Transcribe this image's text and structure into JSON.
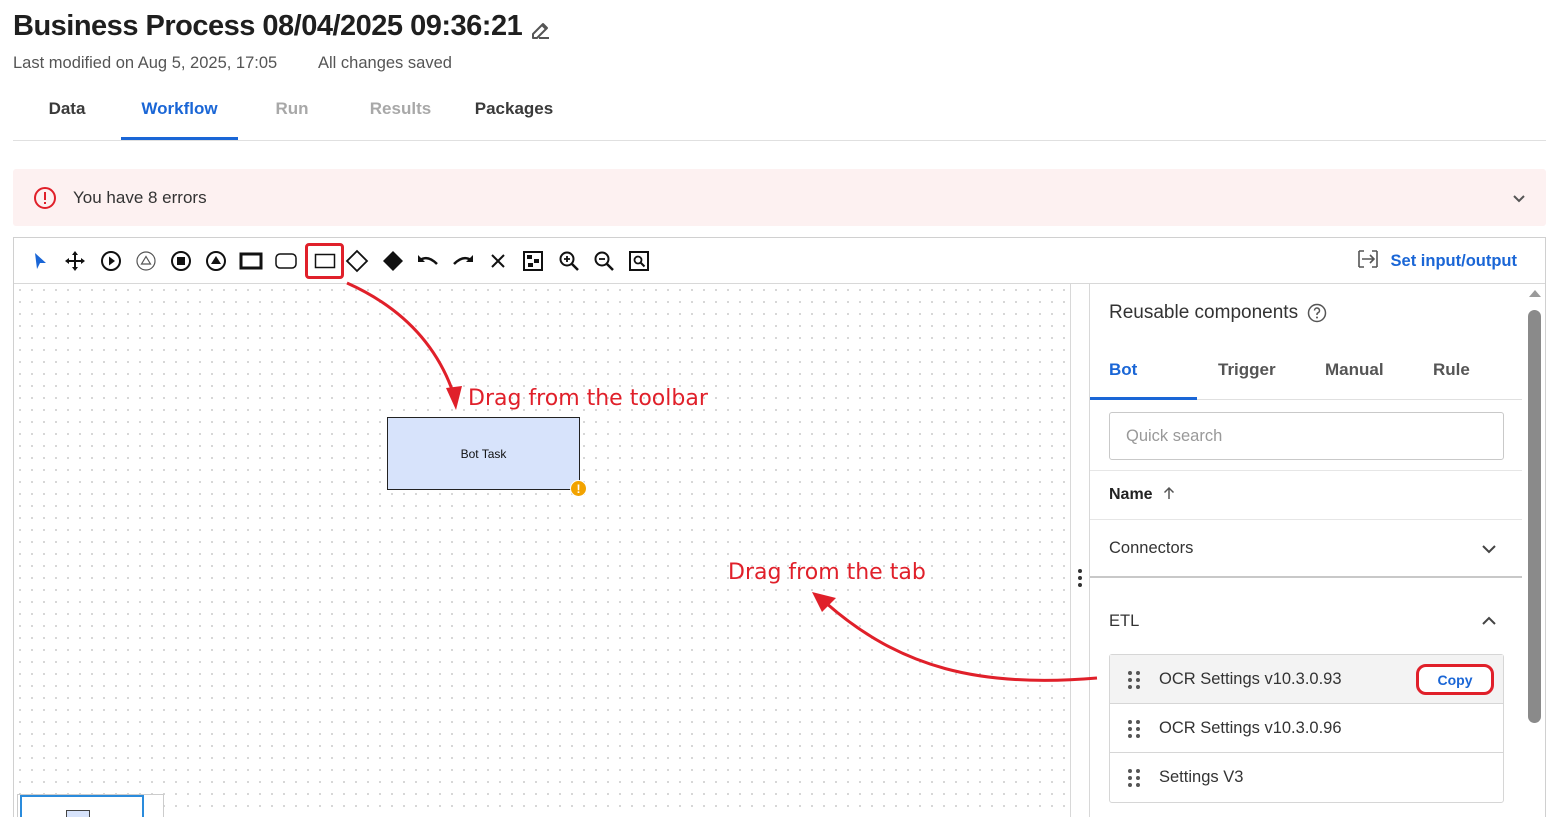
{
  "header": {
    "title": "Business Process 08/04/2025 09:36:21",
    "last_modified": "Last modified on Aug 5, 2025, 17:05",
    "save_status": "All changes saved"
  },
  "tabs": [
    {
      "label": "Data",
      "state": "normal"
    },
    {
      "label": "Workflow",
      "state": "active"
    },
    {
      "label": "Run",
      "state": "disabled"
    },
    {
      "label": "Results",
      "state": "disabled"
    },
    {
      "label": "Packages",
      "state": "normal"
    }
  ],
  "banner": {
    "text": "You have 8 errors",
    "icon": "error-circle-icon"
  },
  "toolbar": {
    "tools": [
      "pointer",
      "move",
      "start-event",
      "signal-event",
      "end-event",
      "escalation-event",
      "task-bold",
      "subprocess",
      "task",
      "exclusive-gateway",
      "parallel-gateway-filled",
      "undo",
      "redo",
      "delete",
      "fit-to-screen",
      "zoom-in",
      "zoom-out",
      "actual-size"
    ],
    "highlighted_tool": "task",
    "set_io_label": "Set input/output"
  },
  "canvas": {
    "node_label": "Bot Task",
    "warning_badge": "!"
  },
  "panel": {
    "title": "Reusable components",
    "tabs": [
      "Bot",
      "Trigger",
      "Manual",
      "Rule"
    ],
    "active_tab": "Bot",
    "search_placeholder": "Quick search",
    "sort_column": "Name",
    "groups": [
      {
        "label": "Connectors",
        "expanded": false
      },
      {
        "label": "ETL",
        "expanded": true
      }
    ],
    "components": [
      {
        "name": "OCR Settings v10.3.0.93",
        "hovered": true
      },
      {
        "name": "OCR Settings v10.3.0.96",
        "hovered": false
      },
      {
        "name": "Settings V3",
        "hovered": false
      }
    ],
    "copy_label": "Copy"
  },
  "annotations": {
    "toolbar_hint": "Drag from the toolbar",
    "tab_hint": "Drag from the tab"
  },
  "colors": {
    "accent": "#1a66d6",
    "annotation_red": "#e0202a",
    "task_fill": "#d7e3fb",
    "error_banner_bg": "#fdf1f1",
    "warning": "#f2a300"
  }
}
